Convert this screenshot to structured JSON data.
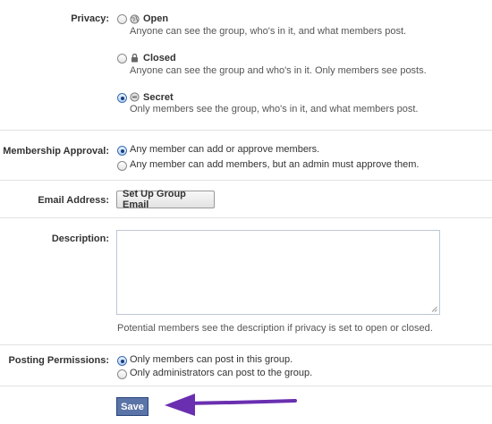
{
  "privacy": {
    "label": "Privacy:",
    "options": [
      {
        "title": "Open",
        "desc": "Anyone can see the group, who's in it, and what members post.",
        "selected": false,
        "icon": "globe-icon"
      },
      {
        "title": "Closed",
        "desc": "Anyone can see the group and who's in it. Only members see posts.",
        "selected": false,
        "icon": "lock-icon"
      },
      {
        "title": "Secret",
        "desc": "Only members see the group, who's in it, and what members post.",
        "selected": true,
        "icon": "secret-icon"
      }
    ]
  },
  "membership_approval": {
    "label": "Membership Approval:",
    "options": [
      {
        "text": "Any member can add or approve members.",
        "selected": true
      },
      {
        "text": "Any member can add members, but an admin must approve them.",
        "selected": false
      }
    ]
  },
  "email_address": {
    "label": "Email Address:",
    "button_label": "Set Up Group Email"
  },
  "description": {
    "label": "Description:",
    "value": "",
    "hint": "Potential members see the description if privacy is set to open or closed."
  },
  "posting_permissions": {
    "label": "Posting Permissions:",
    "options": [
      {
        "text": "Only members can post in this group.",
        "selected": true
      },
      {
        "text": "Only administrators can post to the group.",
        "selected": false
      }
    ]
  },
  "save_label": "Save",
  "annotation": {
    "arrow_color": "#6a2fb0",
    "arrow": "purple-arrow-pointing-to-save"
  }
}
